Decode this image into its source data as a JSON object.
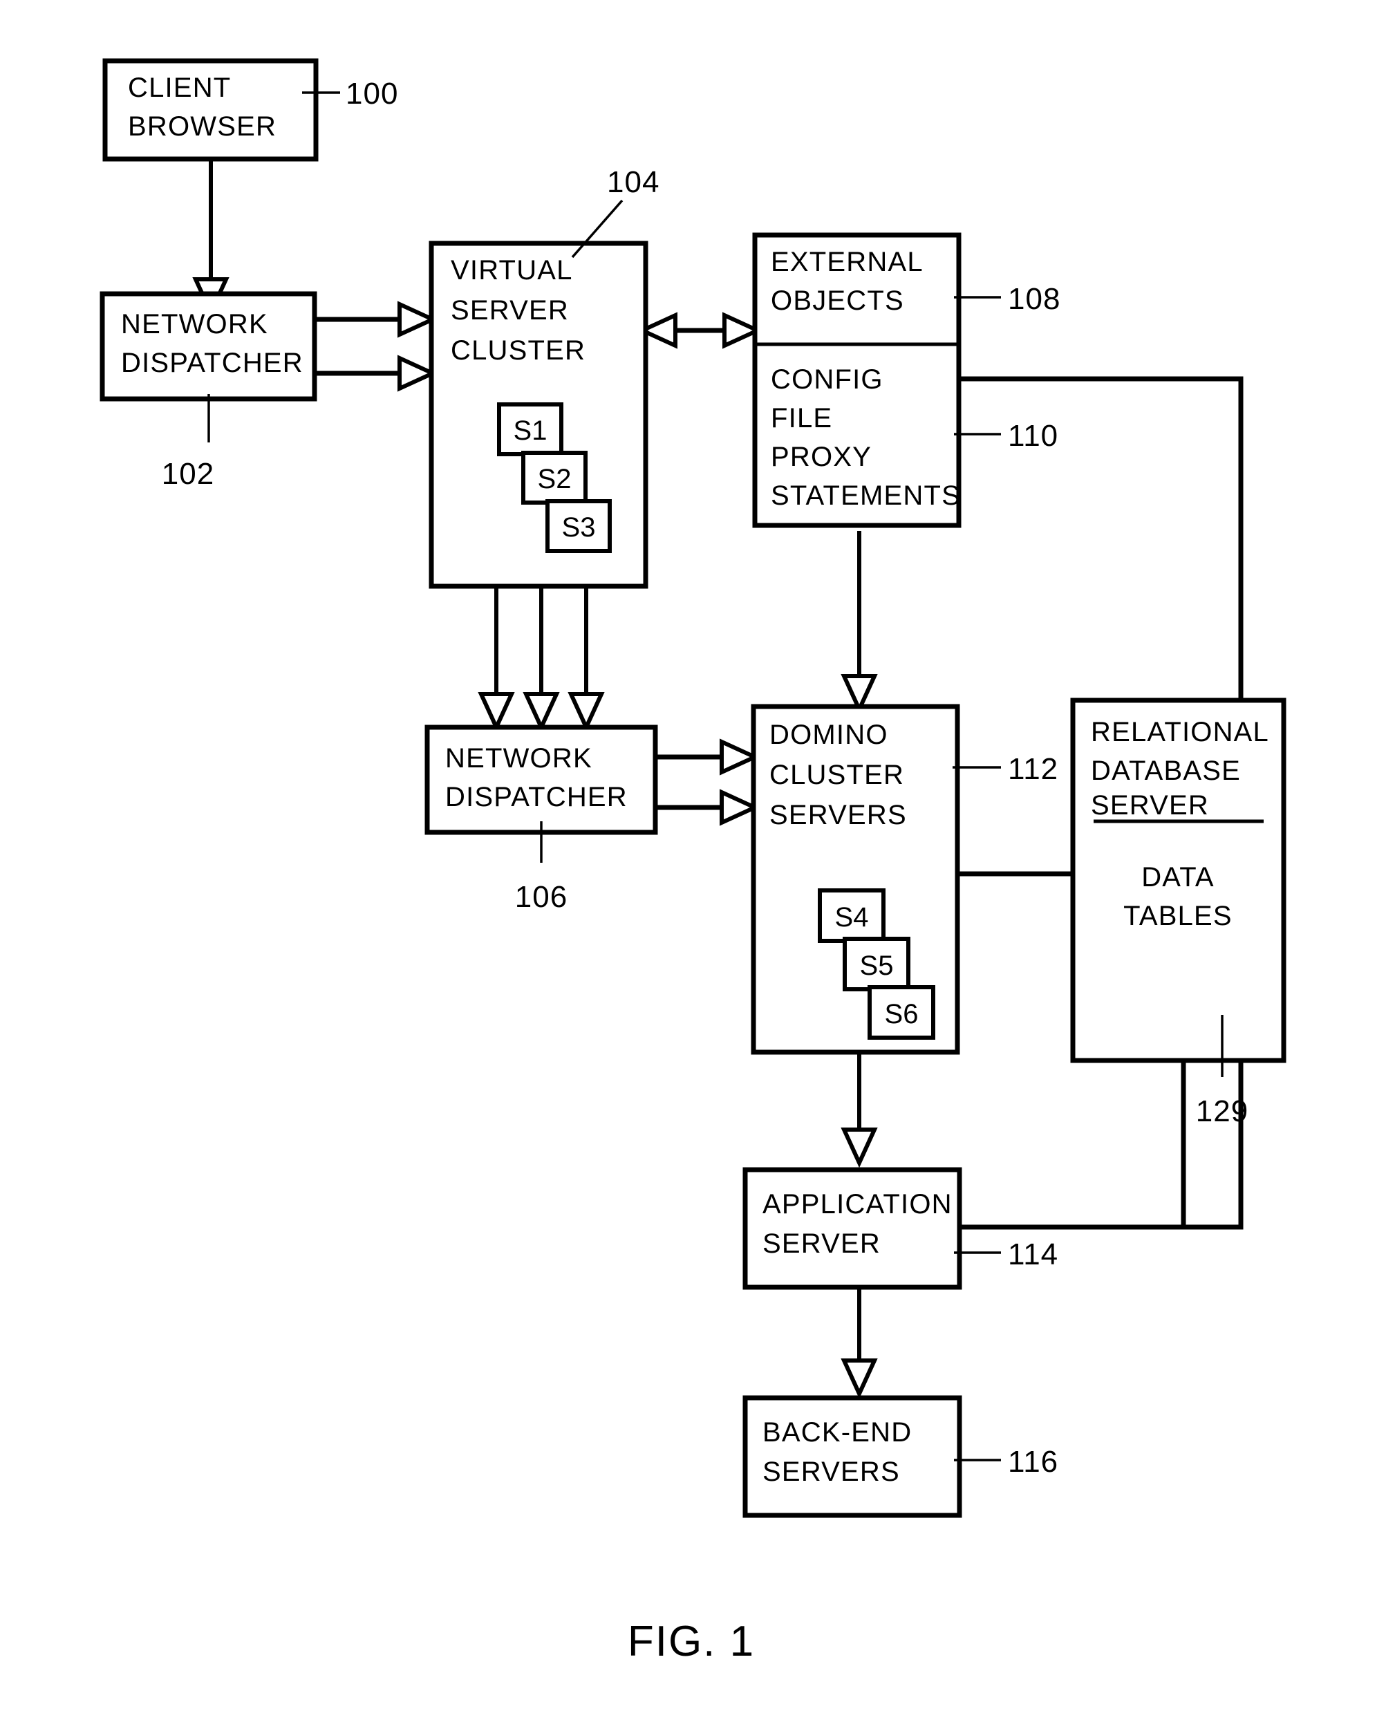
{
  "figure": {
    "caption": "FIG. 1",
    "title": "Virtual server cluster and Domino cluster architecture block diagram"
  },
  "blocks": {
    "client_browser": {
      "line1": "CLIENT",
      "line2": "BROWSER",
      "ref": "100"
    },
    "network_dispatcher_top": {
      "line1": "NETWORK",
      "line2": "DISPATCHER",
      "ref": "102"
    },
    "virtual_server_cluster": {
      "line1": "VIRTUAL",
      "line2": "SERVER",
      "line3": "CLUSTER",
      "ref": "104"
    },
    "network_dispatcher_bottom": {
      "line1": "NETWORK",
      "line2": "DISPATCHER",
      "ref": "106"
    },
    "external_objects": {
      "line1": "EXTERNAL",
      "line2": "OBJECTS",
      "ref": "108"
    },
    "config_file_proxy": {
      "line1": "CONFIG",
      "line2": "FILE",
      "line3": "PROXY",
      "line4": "STATEMENTS",
      "ref": "110"
    },
    "domino_cluster_servers": {
      "line1": "DOMINO",
      "line2": "CLUSTER",
      "line3": "SERVERS",
      "ref": "112"
    },
    "relational_database_server": {
      "line1": "RELATIONAL",
      "line2": "DATABASE",
      "line3": "SERVER",
      "sub1": "DATA",
      "sub2": "TABLES",
      "ref": "129"
    },
    "application_server": {
      "line1": "APPLICATION",
      "line2": "SERVER",
      "ref": "114"
    },
    "back_end_servers": {
      "line1": "BACK-END",
      "line2": "SERVERS",
      "ref": "116"
    }
  },
  "virtual_cluster_servers": [
    {
      "label": "S1"
    },
    {
      "label": "S2"
    },
    {
      "label": "S3"
    }
  ],
  "domino_cluster_servers": [
    {
      "label": "S4"
    },
    {
      "label": "S5"
    },
    {
      "label": "S6"
    }
  ],
  "colors": {
    "stroke": "#000000",
    "fill": "#ffffff"
  }
}
